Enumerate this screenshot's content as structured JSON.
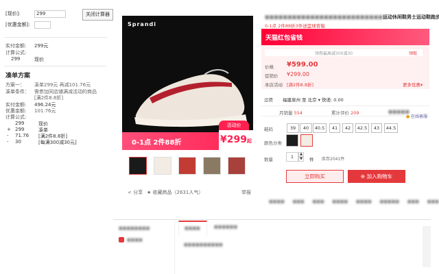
{
  "calc": {
    "price_label": "[现价]:",
    "price_value": "299",
    "coupon_label": "[优惠金额]:",
    "coupon_value": "",
    "close_button": "关闭计算器",
    "paid_label": "实付金额:",
    "paid_value": "299元",
    "formula_label": "计算公式:",
    "formula_rows": [
      {
        "value": "299",
        "desc": "现价"
      }
    ],
    "section_title": "凑单方案",
    "plan_label": "方案一：",
    "plan_value": "凑单299元 再减101.76元",
    "condition_label": "凑单条件：",
    "condition_value": "需参加同店铺满减活动的商品",
    "condition_extra": "[满2件8.8折]",
    "paid2_label": "实付金额:",
    "paid2_value": "496.24元",
    "discount_label": "优惠金额:",
    "discount_value": "101.76元",
    "formula2_label": "计算公式:",
    "formula2_rows": [
      {
        "sign": "",
        "value": "299",
        "desc": "现价"
      },
      {
        "sign": "+",
        "value": "299",
        "desc": "凑单"
      },
      {
        "sign": "-",
        "value": "71.76",
        "desc": "[满2件8.8折]"
      },
      {
        "sign": "-",
        "value": "30",
        "desc": "[每满300减30元]"
      }
    ]
  },
  "product": {
    "title_tail": "运动休闲鞋男士运动鞋跑步鞋V",
    "promo_line": "0-1点 2件88折3件送篮球背箱",
    "banner_text": "天猫红包省钱",
    "price_label": "价格",
    "price": "¥599.00",
    "promo_price_label": "促销价",
    "promo_price": "¥299.00",
    "store_promo_label": "本店活动",
    "store_promo": "[满2件8.8折]",
    "more_discount": "更多优惠",
    "receive_label": "领取",
    "shipping_label": "运费",
    "shipping_text": "福建泉州 至 北京 ▾ 快递: 0.00",
    "monthly_sales_label": "月销量",
    "monthly_sales": "554",
    "reviews_label": "累计评价",
    "reviews": "209",
    "sizes_label": "鞋码",
    "sizes": [
      "39",
      "40",
      "40.5",
      "41",
      "42",
      "42.5",
      "43",
      "44.5"
    ],
    "color_label": "颜色分类",
    "qty_label": "数量",
    "qty": "1",
    "qty_unit": "件",
    "stock": "库存2041件",
    "buy_now": "立即购买",
    "add_cart": "加入购物车",
    "share": "分享",
    "favorite": "收藏商品（2631人气）",
    "report": "举报",
    "image_promo_tag": "活动价",
    "image_promo_text": "0-1点 2件88折",
    "image_price": "¥299",
    "image_price_unit": "起",
    "image_brand": "Sprandi",
    "customer_service": "在线客服"
  },
  "colors": {
    "accent": "#e4393c",
    "banner": "#ff0036"
  }
}
